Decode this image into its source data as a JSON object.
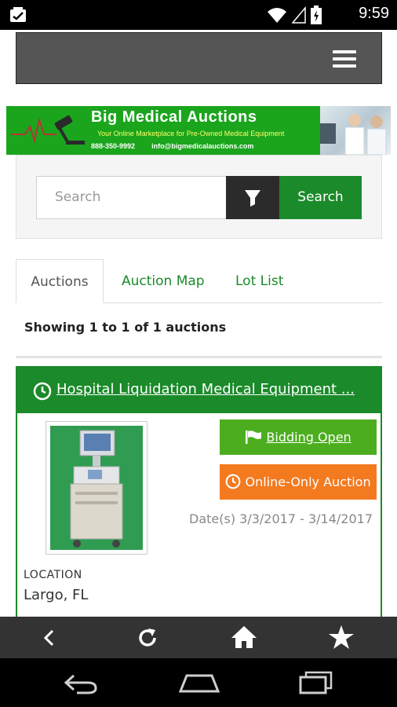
{
  "status_bar": {
    "time": "9:59",
    "icons": [
      "notification-icon",
      "wifi-icon",
      "signal-icon",
      "battery-icon"
    ]
  },
  "navbar": {
    "menu_icon": "hamburger-menu-icon"
  },
  "banner": {
    "title": "Big Medical Auctions",
    "tagline": "Your Online Marketplace for Pre-Owned Medical Equipment",
    "phone": "888-350-9992",
    "email": "info@bigmedicalauctions.com"
  },
  "search": {
    "placeholder": "Search",
    "filter_icon": "filter-icon",
    "button_label": "Search"
  },
  "tabs": [
    {
      "label": "Auctions",
      "active": true
    },
    {
      "label": "Auction Map",
      "active": false
    },
    {
      "label": "Lot List",
      "active": false
    }
  ],
  "results": {
    "summary": "Showing 1 to 1 of 1 auctions"
  },
  "auction": {
    "title": "Hospital Liquidation Medical Equipment ...",
    "status_label": "Bidding Open",
    "type_label": "Online-Only Auction",
    "dates": "Date(s) 3/3/2017 - 3/14/2017",
    "location_label": "LOCATION",
    "location": "Largo, FL"
  },
  "browser_toolbar": {
    "items": [
      "back-icon",
      "reload-icon",
      "home-icon",
      "star-icon"
    ]
  },
  "system_nav": {
    "items": [
      "back-nav-icon",
      "home-nav-icon",
      "recents-nav-icon"
    ]
  },
  "colors": {
    "brand_green": "#1b8a2a",
    "bid_green": "#4cae1f",
    "orange": "#f47a20",
    "navbar_gray": "#555555"
  }
}
